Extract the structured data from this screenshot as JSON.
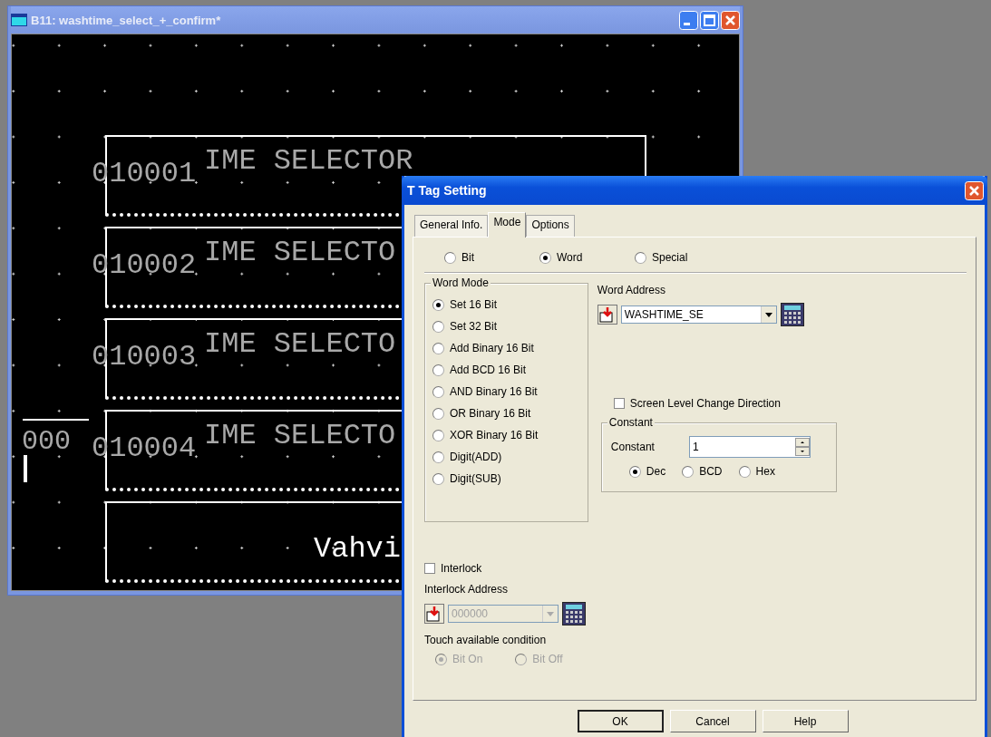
{
  "editor_window": {
    "title": "B11: washtime_select_+_confirm*",
    "rows": [
      {
        "code": "010001",
        "label": "IME SELECTOR"
      },
      {
        "code": "010002",
        "label": "IME SELECTO"
      },
      {
        "code": "010003",
        "label": "IME SELECTO"
      },
      {
        "code": "010004",
        "label": "IME SELECTO"
      }
    ],
    "side_value": "000",
    "confirm_text": "Vahvi"
  },
  "dialog": {
    "title": "T Tag Setting",
    "tabs": [
      {
        "label": "General Info.",
        "selected": false
      },
      {
        "label": "Mode",
        "selected": true
      },
      {
        "label": "Options",
        "selected": false
      }
    ],
    "mode_options": [
      {
        "label": "Bit",
        "selected": false
      },
      {
        "label": "Word",
        "selected": true
      },
      {
        "label": "Special",
        "selected": false
      }
    ],
    "word_mode": {
      "title": "Word Mode",
      "options": [
        {
          "label": "Set 16 Bit",
          "selected": true
        },
        {
          "label": "Set 32 Bit",
          "selected": false
        },
        {
          "label": "Add Binary 16 Bit",
          "selected": false
        },
        {
          "label": "Add BCD 16 Bit",
          "selected": false
        },
        {
          "label": "AND Binary 16 Bit",
          "selected": false
        },
        {
          "label": "OR Binary 16 Bit",
          "selected": false
        },
        {
          "label": "XOR Binary 16 Bit",
          "selected": false
        },
        {
          "label": "Digit(ADD)",
          "selected": false
        },
        {
          "label": "Digit(SUB)",
          "selected": false
        }
      ]
    },
    "word_address": {
      "label": "Word Address",
      "value": "WASHTIME_SE",
      "disabled": false
    },
    "screen_level_change": {
      "label": "Screen Level Change Direction",
      "checked": false
    },
    "constant": {
      "title": "Constant",
      "label": "Constant",
      "value": "1",
      "formats": [
        {
          "label": "Dec",
          "selected": true
        },
        {
          "label": "BCD",
          "selected": false
        },
        {
          "label": "Hex",
          "selected": false
        }
      ]
    },
    "interlock": {
      "label": "Interlock",
      "checked": false
    },
    "interlock_address": {
      "label": "Interlock Address",
      "value": "000000",
      "disabled": true
    },
    "touch_condition": {
      "label": "Touch available condition",
      "disabled": true,
      "options": [
        {
          "label": "Bit On",
          "selected": true
        },
        {
          "label": "Bit Off",
          "selected": false
        }
      ]
    },
    "buttons": [
      {
        "label": "OK",
        "default": true
      },
      {
        "label": "Cancel",
        "default": false
      },
      {
        "label": "Help",
        "default": false
      }
    ]
  }
}
